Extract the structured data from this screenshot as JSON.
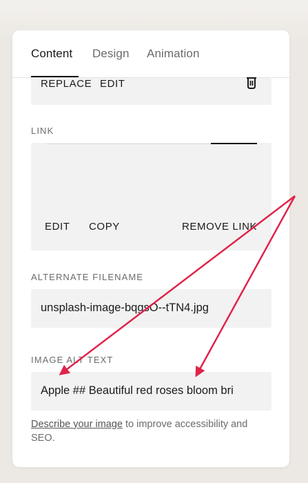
{
  "tabs": [
    {
      "label": "Content"
    },
    {
      "label": "Design"
    },
    {
      "label": "Animation"
    }
  ],
  "image_actions": {
    "replace_label": "REPLACE",
    "edit_label": "EDIT"
  },
  "link": {
    "section_label": "LINK",
    "edit_label": "EDIT",
    "copy_label": "COPY",
    "remove_label": "REMOVE LINK"
  },
  "alternate_filename": {
    "section_label": "ALTERNATE FILENAME",
    "value": "unsplash-image-bqgsO--tTN4.jpg"
  },
  "image_alt_text": {
    "section_label": "IMAGE ALT TEXT",
    "value": "Apple ## Beautiful red roses bloom bri"
  },
  "help": {
    "link_text": "Describe your image",
    "rest_text": " to improve accessibility and SEO."
  },
  "colors": {
    "annotation_arrow": "#e0234a",
    "active_tab": "#1a1a1a",
    "inactive_tab": "#6b6b6b"
  },
  "icons": {
    "delete": "trash-icon"
  }
}
